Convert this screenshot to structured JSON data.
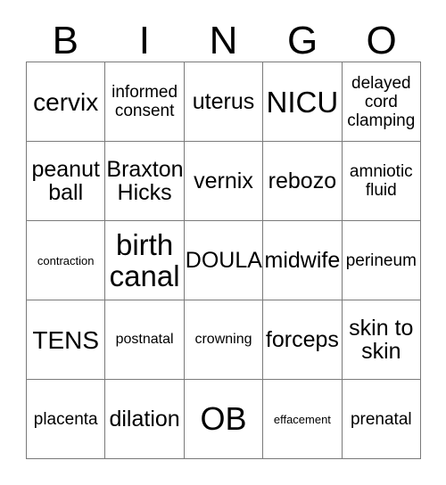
{
  "card": {
    "title": "BINGO",
    "columns": [
      "B",
      "I",
      "N",
      "G",
      "O"
    ],
    "border_color": "#7a7a7a",
    "text_color": "#000000",
    "background_color": "#ffffff",
    "rows": 5,
    "cols": 5,
    "cells": [
      {
        "text": "cervix",
        "size": "lg"
      },
      {
        "text": "informed\nconsent",
        "size": "sm"
      },
      {
        "text": "uterus",
        "size": "md"
      },
      {
        "text": "NICU",
        "size": "xl"
      },
      {
        "text": "delayed\ncord\nclamping",
        "size": "sm"
      },
      {
        "text": "peanut\nball",
        "size": "md"
      },
      {
        "text": "Braxton\nHicks",
        "size": "md"
      },
      {
        "text": "vernix",
        "size": "md"
      },
      {
        "text": "rebozo",
        "size": "md"
      },
      {
        "text": "amniotic\nfluid",
        "size": "sm"
      },
      {
        "text": "contraction",
        "size": "xxs"
      },
      {
        "text": "birth\ncanal",
        "size": "xl"
      },
      {
        "text": "DOULA",
        "size": "md"
      },
      {
        "text": "midwife",
        "size": "md"
      },
      {
        "text": "perineum",
        "size": "sm"
      },
      {
        "text": "TENS",
        "size": "lg"
      },
      {
        "text": "postnatal",
        "size": "xs"
      },
      {
        "text": "crowning",
        "size": "xs"
      },
      {
        "text": "forceps",
        "size": "md"
      },
      {
        "text": "skin to\nskin",
        "size": "md"
      },
      {
        "text": "placenta",
        "size": "sm"
      },
      {
        "text": "dilation",
        "size": "md"
      },
      {
        "text": "OB",
        "size": "xxl"
      },
      {
        "text": "effacement",
        "size": "xxs"
      },
      {
        "text": "prenatal",
        "size": "sm"
      }
    ]
  }
}
